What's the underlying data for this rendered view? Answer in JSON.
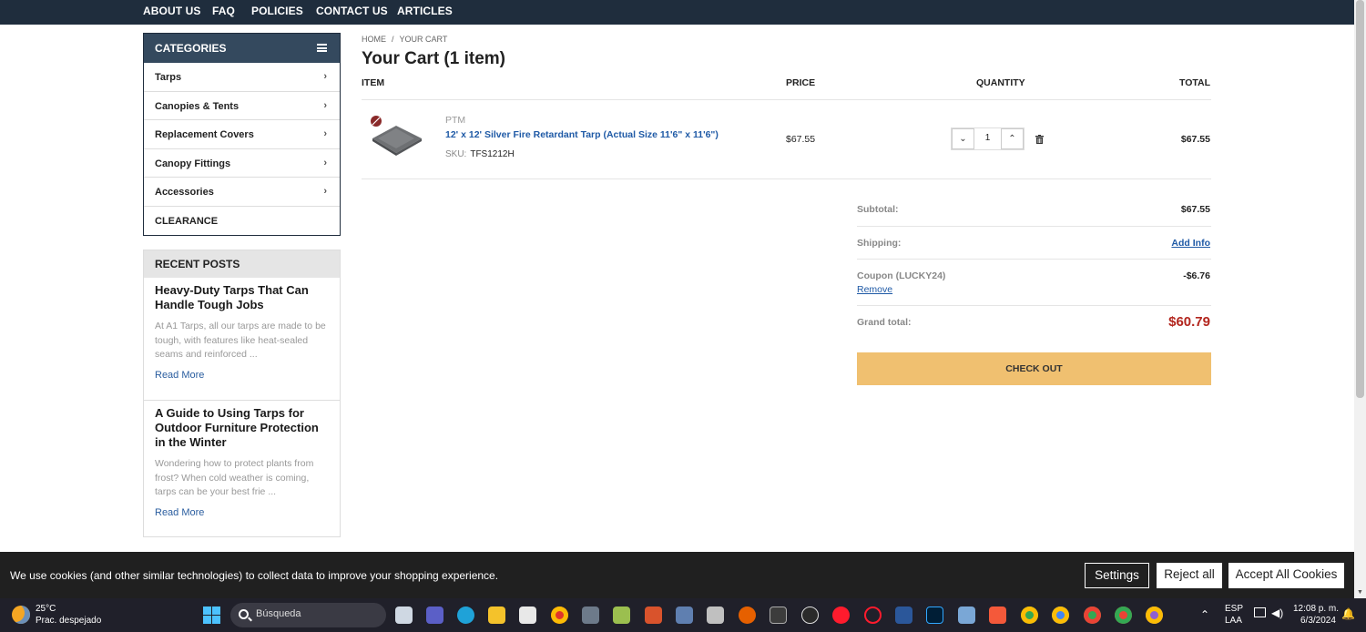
{
  "topnav": [
    "ABOUT US",
    "FAQ",
    "POLICIES",
    "CONTACT US",
    "ARTICLES"
  ],
  "sidebar": {
    "categories_title": "CATEGORIES",
    "categories": [
      "Tarps",
      "Canopies & Tents",
      "Replacement Covers",
      "Canopy Fittings",
      "Accessories",
      "CLEARANCE"
    ],
    "recent_posts_title": "RECENT POSTS",
    "posts": [
      {
        "title": "Heavy-Duty Tarps That Can Handle Tough Jobs",
        "excerpt": "At A1 Tarps, all our tarps are made to be tough, with features like heat-sealed seams and reinforced ...",
        "link": "Read More"
      },
      {
        "title": "A Guide to Using Tarps for Outdoor Furniture Protection in the Winter",
        "excerpt": "Wondering how to protect plants from frost? When cold weather is coming, tarps can be your best frie ...",
        "link": "Read More"
      }
    ]
  },
  "breadcrumb": {
    "home": "HOME",
    "sep": "/",
    "current": "YOUR CART"
  },
  "cart": {
    "title": "Your Cart (1 item)",
    "headers": {
      "item": "ITEM",
      "price": "PRICE",
      "quantity": "QUANTITY",
      "total": "TOTAL"
    },
    "item": {
      "brand": "PTM",
      "name": "12' x 12' Silver Fire Retardant Tarp (Actual Size 11'6\" x 11'6\")",
      "sku_label": "SKU:",
      "sku": "TFS1212H",
      "price": "$67.55",
      "quantity": "1",
      "total": "$67.55"
    },
    "summary": {
      "subtotal_label": "Subtotal:",
      "subtotal": "$67.55",
      "shipping_label": "Shipping:",
      "shipping_action": "Add Info",
      "coupon_label": "Coupon (LUCKY24)",
      "coupon_value": "-$6.76",
      "coupon_remove": "Remove",
      "grand_label": "Grand total:",
      "grand": "$60.79"
    },
    "checkout": "CHECK OUT"
  },
  "cookie": {
    "message": "We use cookies (and other similar technologies) to collect data to improve your shopping experience.",
    "settings": "Settings",
    "reject": "Reject all",
    "accept": "Accept All Cookies"
  },
  "taskbar": {
    "temp": "25°C",
    "weather": "Prac. despejado",
    "search_placeholder": "Búsqueda",
    "lang1": "ESP",
    "lang2": "LAA",
    "time": "12:08 p. m.",
    "date": "6/3/2024"
  },
  "colors": {
    "nav": "#1f2d3d",
    "accent_link": "#1f5aa6",
    "grand_total": "#b3261e",
    "checkout": "#f0c070"
  }
}
